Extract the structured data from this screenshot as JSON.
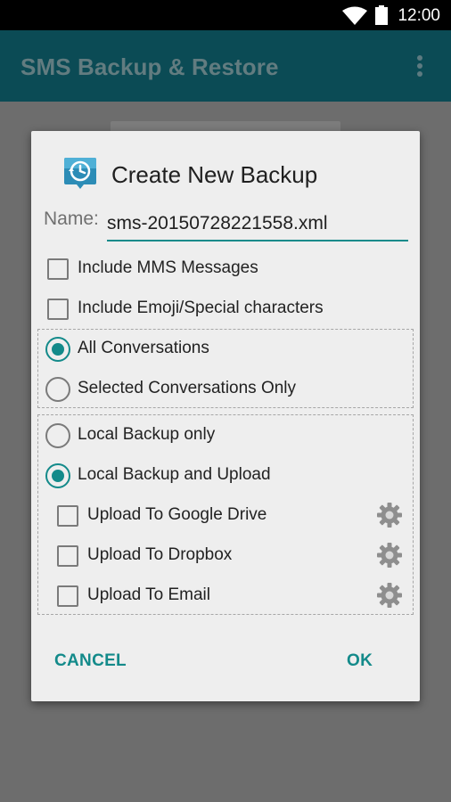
{
  "status_bar": {
    "time": "12:00",
    "wifi_icon": "wifi-icon",
    "battery_icon": "battery-icon"
  },
  "app_bar": {
    "title": "SMS Backup & Restore",
    "menu_icon": "overflow-menu-icon"
  },
  "dialog": {
    "title": "Create New Backup",
    "icon": "backup-clock-icon",
    "name_label": "Name:",
    "name_value": "sms-20150728221558.xml",
    "options": {
      "include_mms": {
        "label": "Include MMS Messages",
        "checked": false
      },
      "include_emoji": {
        "label": "Include Emoji/Special characters",
        "checked": false
      }
    },
    "conversations": [
      {
        "label": "All Conversations",
        "selected": true
      },
      {
        "label": "Selected Conversations Only",
        "selected": false
      }
    ],
    "backup_mode": [
      {
        "label": "Local Backup only",
        "selected": false
      },
      {
        "label": "Local Backup and Upload",
        "selected": true
      }
    ],
    "uploads": [
      {
        "label": "Upload To Google Drive",
        "checked": false,
        "settings_icon": "gear-icon"
      },
      {
        "label": "Upload To Dropbox",
        "checked": false,
        "settings_icon": "gear-icon"
      },
      {
        "label": "Upload To Email",
        "checked": false,
        "settings_icon": "gear-icon"
      }
    ],
    "buttons": {
      "cancel": "CANCEL",
      "ok": "OK"
    }
  },
  "colors": {
    "accent": "#138a8a",
    "app_bar": "#0b4b55",
    "dialog_bg": "#eeeeee",
    "scrim": "#6d6d6d"
  }
}
